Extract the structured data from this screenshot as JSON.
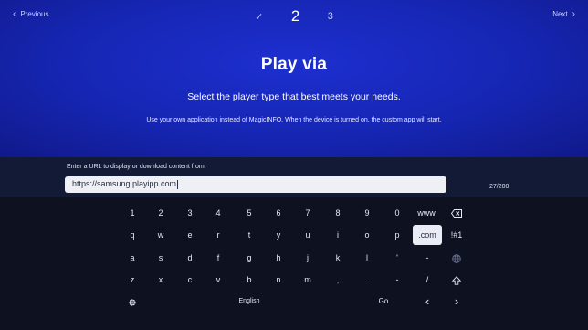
{
  "nav": {
    "previous": "Previous",
    "next": "Next"
  },
  "steps": {
    "done": "✓",
    "current": "2",
    "upcoming": "3"
  },
  "title": "Play via",
  "subtitle": "Select the player type that best meets your needs.",
  "description": "Use your own application instead of MagicINFO. When the device is turned on, the custom app will start.",
  "url": {
    "label": "Enter a URL to display or download content from.",
    "value": "https://samsung.playipp.com",
    "counter": "27/200"
  },
  "keyboard": {
    "row1": [
      "1",
      "2",
      "3",
      "4",
      "5",
      "6",
      "7",
      "8",
      "9",
      "0",
      "www."
    ],
    "row2": [
      "q",
      "w",
      "e",
      "r",
      "t",
      "y",
      "u",
      "i",
      "o",
      "p",
      ".com",
      "!#1"
    ],
    "row3": [
      "a",
      "s",
      "d",
      "f",
      "g",
      "h",
      "j",
      "k",
      "l",
      "'",
      "-"
    ],
    "row4": [
      "z",
      "x",
      "c",
      "v",
      "b",
      "n",
      "m",
      ",",
      ".",
      "-",
      "/"
    ],
    "language": "English",
    "go": "Go"
  }
}
